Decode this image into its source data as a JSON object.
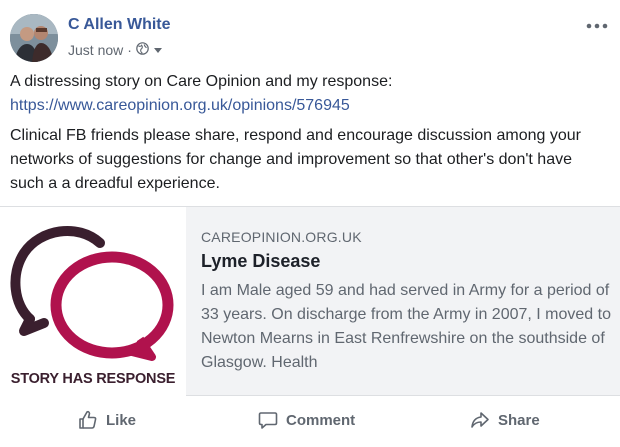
{
  "post": {
    "author": "C Allen White",
    "timestamp": "Just now",
    "privacy_icon": "globe-icon",
    "line1": "A distressing story on Care Opinion and my response:",
    "link": "https://www.careopinion.org.uk/opinions/576945",
    "body": "Clinical FB friends please share, respond and encourage discussion among your networks of suggestions for change and improvement so that other's don't have such a a dreadful experience."
  },
  "card": {
    "thumbnail_caption": "STORY HAS RESPONSE",
    "domain": "CAREOPINION.ORG.UK",
    "title": "Lyme Disease",
    "description": "I am Male aged 59 and had served in Army for a period of 33 years. On discharge from the Army in 2007, I moved to Newton Mearns in East Renfrewshire on the southside of Glasgow. Health"
  },
  "actions": {
    "like": "Like",
    "comment": "Comment",
    "share": "Share"
  },
  "colors": {
    "link": "#385898",
    "bubble_dark": "#3a1f2e",
    "bubble_pink": "#b0124d",
    "card_bg": "#f2f3f5"
  }
}
